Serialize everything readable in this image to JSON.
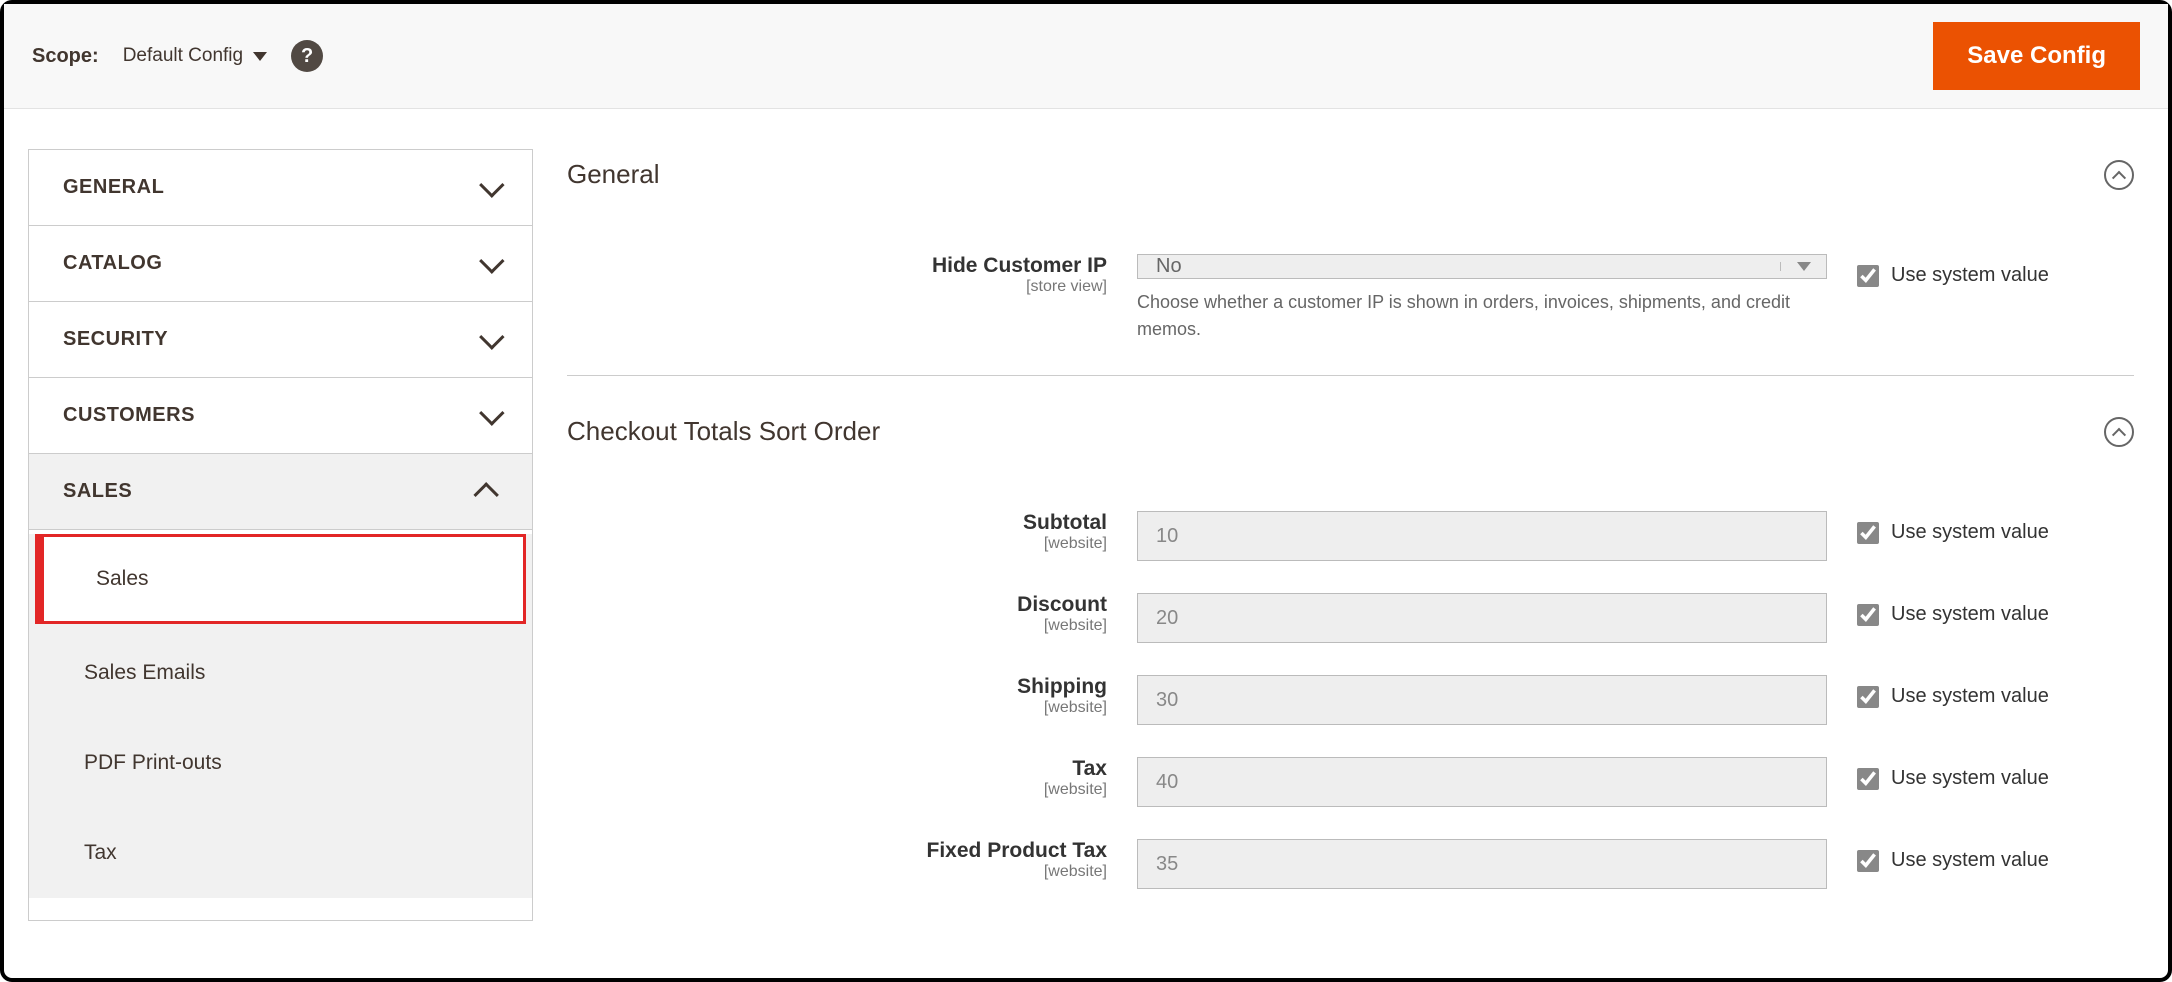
{
  "topbar": {
    "scope_label": "Scope:",
    "scope_value": "Default Config",
    "save_btn": "Save Config"
  },
  "sidebar": {
    "groups": [
      {
        "label": "GENERAL",
        "expanded": false
      },
      {
        "label": "CATALOG",
        "expanded": false
      },
      {
        "label": "SECURITY",
        "expanded": false
      },
      {
        "label": "CUSTOMERS",
        "expanded": false
      },
      {
        "label": "SALES",
        "expanded": true,
        "items": [
          {
            "label": "Sales",
            "active": true
          },
          {
            "label": "Sales Emails",
            "active": false
          },
          {
            "label": "PDF Print-outs",
            "active": false
          },
          {
            "label": "Tax",
            "active": false
          }
        ]
      }
    ]
  },
  "sections": {
    "general": {
      "title": "General",
      "hide_ip_label": "Hide Customer IP",
      "hide_ip_scope": "[store view]",
      "hide_ip_value": "No",
      "hide_ip_help": "Choose whether a customer IP is shown in orders, invoices, shipments, and credit memos.",
      "sys_label": "Use system value"
    },
    "checkout": {
      "title": "Checkout Totals Sort Order",
      "scope": "[website]",
      "rows": [
        {
          "label": "Subtotal",
          "value": "10"
        },
        {
          "label": "Discount",
          "value": "20"
        },
        {
          "label": "Shipping",
          "value": "30"
        },
        {
          "label": "Tax",
          "value": "40"
        },
        {
          "label": "Fixed Product Tax",
          "value": "35"
        }
      ],
      "sys_label": "Use system value"
    }
  }
}
